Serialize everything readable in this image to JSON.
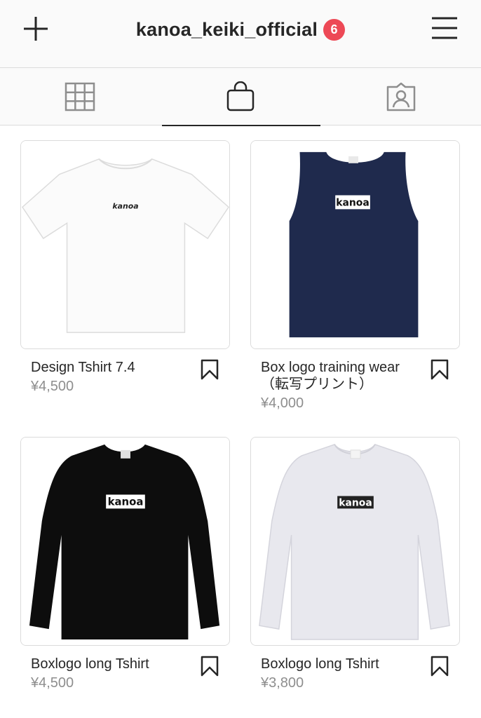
{
  "header": {
    "username": "kanoa_keiki_official",
    "notification_count": "6"
  },
  "tabs": [
    {
      "name": "grid-icon"
    },
    {
      "name": "shopping-bag-icon",
      "active": true
    },
    {
      "name": "tagged-person-icon"
    }
  ],
  "products": [
    {
      "name": "Design Tshirt 7.4",
      "name_line2": "",
      "price": "¥4,500",
      "shirt": "white-tee",
      "logo_text": "kanoa"
    },
    {
      "name": "Box logo training wear",
      "name_line2": "（転写プリント）",
      "price": "¥4,000",
      "shirt": "navy-tank",
      "logo_text": "kanoa"
    },
    {
      "name": "Boxlogo long Tshirt",
      "name_line2": "",
      "price": "¥4,500",
      "shirt": "black-longsleeve",
      "logo_text": "kanoa"
    },
    {
      "name": "Boxlogo long Tshirt",
      "name_line2": "",
      "price": "¥3,800",
      "shirt": "white-longsleeve",
      "logo_text": "kanoa"
    }
  ],
  "colors": {
    "badge": "#ed4956",
    "navy": "#1f2a4d",
    "text": "#262626",
    "muted": "#8e8e8e"
  }
}
